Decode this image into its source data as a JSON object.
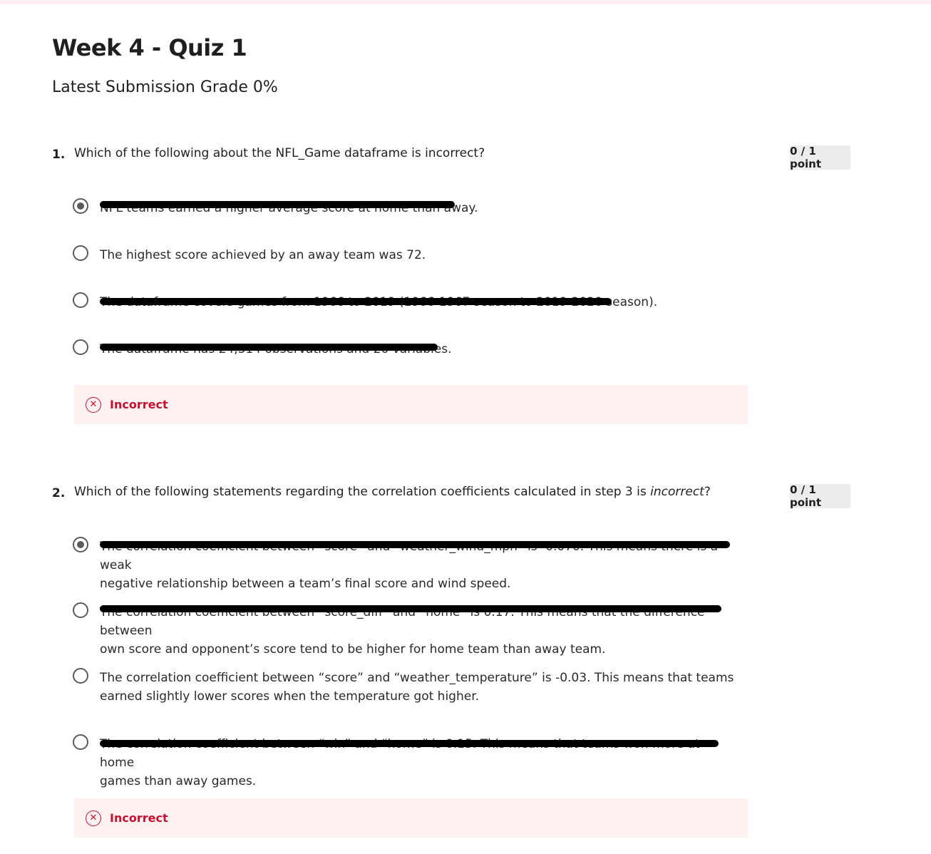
{
  "quiz": {
    "title": "Week 4 - Quiz 1",
    "grade": "Latest Submission Grade 0%"
  },
  "questions": [
    {
      "number": "1.",
      "text": "Which of the following about the NFL_Game dataframe is incorrect?",
      "points": "0 / 1 point",
      "options": [
        {
          "text": "NFL teams earned a higher average score at home than away.",
          "selected": true
        },
        {
          "text": "The highest score achieved by an away team was 72.",
          "selected": false
        },
        {
          "text": "The dataframe covers games from 1966 to 2019 (1966-1967 season to 2019-2020 season).",
          "selected": false
        },
        {
          "text": "The dataframe has 24,314 observations and 20 variables.",
          "selected": false
        }
      ],
      "feedback": "Incorrect"
    },
    {
      "number": "2.",
      "text_before": "Which of the following statements regarding the correlation coefficients calculated in step 3 is ",
      "text_emph": "incorrect",
      "text_after": "?",
      "points": "0 / 1 point",
      "options": [
        {
          "line1": "The correlation coefficient between “score” and “weather_wind_mph” is -0.070. This means there is a weak",
          "line2": "negative relationship between a team’s final score and wind speed.",
          "selected": true
        },
        {
          "line1": "The correlation coefficient between “score_diff” and “home” is 0.17. This means that the difference between",
          "line2": "own score and opponent’s score tend to be higher for home team than away team.",
          "selected": false
        },
        {
          "line1": "The correlation coefficient between “score” and “weather_temperature” is -0.03. This means that teams",
          "line2": "earned slightly lower scores when the temperature got higher.",
          "selected": false
        },
        {
          "line1": "The correlation coefficient between “win” and “home” is 0.15. This means that teams won more at home",
          "line2": "games than away games.",
          "selected": false
        }
      ],
      "feedback": "Incorrect"
    }
  ],
  "colors": {
    "incorrect": "#c8102e",
    "feedback_bg": "#fdf1f2",
    "points_bg": "#ececec"
  }
}
